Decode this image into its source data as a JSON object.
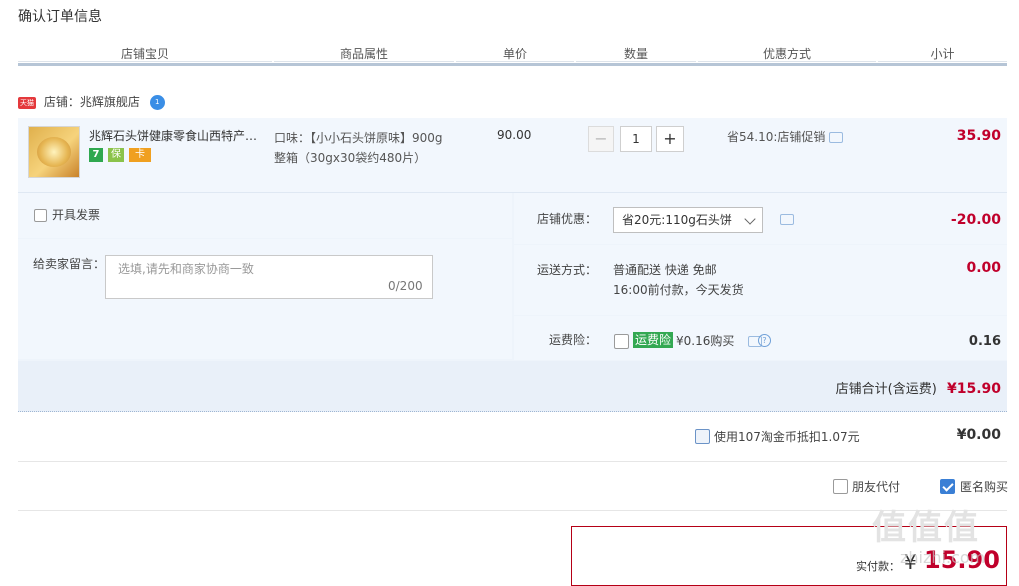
{
  "page": {
    "title": "确认订单信息"
  },
  "columns": [
    "店铺宝贝",
    "商品属性",
    "单价",
    "数量",
    "优惠方式",
    "小计"
  ],
  "shop": {
    "tag": "天猫",
    "label": "店铺：兆辉旗舰店",
    "chat_badge": "1"
  },
  "item": {
    "title": "兆辉石头饼健康零食山西特产休闲食品",
    "badges": [
      "7",
      "保",
      "卡"
    ],
    "attr_line1": "口味：【小小石头饼原味】900g",
    "attr_line2": "整箱（30gx30袋约480片）",
    "unit_price": "90.00",
    "qty_minus": "−",
    "quantity": "1",
    "qty_plus": "+",
    "promo": "省54.10:店铺促销",
    "subtotal": "35.90"
  },
  "invoice": {
    "label": "开具发票"
  },
  "message": {
    "label": "给卖家留言：",
    "placeholder": "选填,请先和商家协商一致",
    "count": "0/200"
  },
  "shop_discount": {
    "label": "店铺优惠：",
    "selected": "省20元:110g石头饼",
    "value": "-20.00"
  },
  "shipping": {
    "label": "运送方式：",
    "line1": "普通配送 快递 免邮",
    "line2": "16:00前付款，今天发货",
    "value": "0.00"
  },
  "insurance": {
    "label": "运费险：",
    "tag": "运费险",
    "text": "¥0.16购买",
    "help": "?",
    "value": "0.16"
  },
  "shop_total": {
    "label": "店铺合计(含运费)",
    "value": "¥15.90"
  },
  "coins": {
    "label": "使用107淘金币抵扣1.07元",
    "value": "¥0.00"
  },
  "options": {
    "friend_pay": "朋友代付",
    "anonymous": "匿名购买"
  },
  "final": {
    "label": "实付款：",
    "currency": "¥",
    "value": "15.90"
  },
  "watermark": {
    "text": "值值值",
    "sub": "zhizhi.com"
  }
}
